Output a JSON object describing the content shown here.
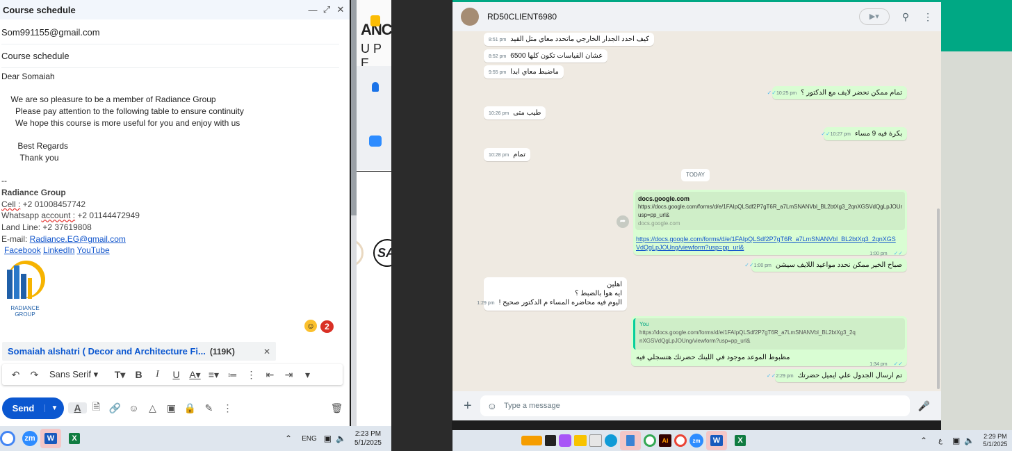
{
  "compose": {
    "title": "Course schedule",
    "to": "Som991155@gmail.com",
    "subject": "Course schedule",
    "body": [
      "Dear  Somaiah",
      "",
      "    We are so pleasure to be a member of Radiance Group",
      "      Please pay attention to the following table to ensure continuity",
      "      We hope this course is more useful for you and enjoy with us",
      "",
      "       Best Regards",
      "        Thank you",
      "",
      "--"
    ],
    "signature": {
      "company": "Radiance Group",
      "cell_label": "Cell :",
      "cell_value": " +2 01008457742",
      "whatsapp_prefix": "Whatsapp ",
      "whatsapp_account": "account :",
      "whatsapp_value": " +2 01144472949",
      "landline": "Land Line: +2 37619808",
      "email_label": "E-mail: ",
      "email_value": "Radiance.EG@gmail.com",
      "facebook": "Facebook",
      "linkedin": "LinkedIn",
      "youtube": "YouTube ",
      "logo_text_1": "RADIANCE",
      "logo_text_2": "GROUP"
    },
    "notification_count": "2",
    "attachment": {
      "name": "Somaiah alshatri ( Decor and Architecture Fi...",
      "size": "(119K)"
    },
    "font_name": "Sans Serif",
    "send_label": "Send"
  },
  "strip": {
    "text_1": "ANCE",
    "text_2": "U P E",
    "text_3": "SA"
  },
  "taskbar_left": {
    "lang": "ENG",
    "time": "2:23 PM",
    "date": "5/1/2025"
  },
  "whatsapp": {
    "contact": "RD50CLIENT6980",
    "messages": [
      {
        "text": "كيف احدد الجدار الخارجي ماتحدد معاي مثل القيد",
        "time": "8:51 pm",
        "dir": "in"
      },
      {
        "text": "عشان القياسات تكون كلها 6500",
        "time": "8:52 pm",
        "dir": "in"
      },
      {
        "text": "ماضبط معاي ابدا",
        "time": "9:55 pm",
        "dir": "in"
      },
      {
        "text": "تمام ممكن نحضر لايف مع الدكتور ؟",
        "time": "10:25 pm",
        "dir": "out"
      },
      {
        "text": "طيب متى",
        "time": "10:26 pm",
        "dir": "in"
      },
      {
        "text": "بكرة فيه 9 مساء",
        "time": "10:27 pm",
        "dir": "out"
      },
      {
        "text": "تمام",
        "time": "10:28 pm",
        "dir": "in"
      }
    ],
    "today_label": "TODAY",
    "link_preview": {
      "title": "docs.google.com",
      "url_line1": "https://docs.google.com/forms/d/e/1FAIpQLSdf2P7gT6R_a7LmSNANVbl_BL2btXg3_2qnXGSVdQgLpJOUng/v",
      "url_line2": "usp=pp_url&",
      "domain": "docs.google.com",
      "link_1": "https://docs.google.com/forms/d/e/1FAIpQLSdf2P7gT6R_a7LmSNANVbl_BL2btXg3_2qnXGS",
      "link_2": "VdQgLpJOUng/viewform?usp=pp_url&",
      "time": "1:00 pm"
    },
    "morning_msg": {
      "text": "صباح الخير ممكن نحدد مواعيد اللايف سيشن",
      "time": "1:00 pm"
    },
    "multi_msg": {
      "line1": "اهلين",
      "line2": "ايه هوا بالضبط ؟",
      "line3": "اليوم فيه محاضره المساء م الدكتور صحيح !",
      "time": "1:29 pm"
    },
    "reply_msg": {
      "quoted_author": "You",
      "quoted_1": "https://docs.google.com/forms/d/e/1FAIpQLSdf2P7gT6R_a7LmSNANVbl_BL2btXg3_2q",
      "quoted_2": "nXGSVdQgLpJOUng/viewform?usp=pp_url&",
      "text": "مظبوط الموعد موجود في اللينك حضرتك هتسجلي فيه",
      "time": "1:34 pm"
    },
    "last_msg": {
      "text": "تم ارسال الجدول علي ايميل حضرتك",
      "time": "2:29 pm"
    },
    "input_placeholder": "Type a message"
  },
  "taskbar_right": {
    "search_label": "",
    "lang": "ع",
    "time": "2:29 PM",
    "date": "5/1/2025"
  }
}
